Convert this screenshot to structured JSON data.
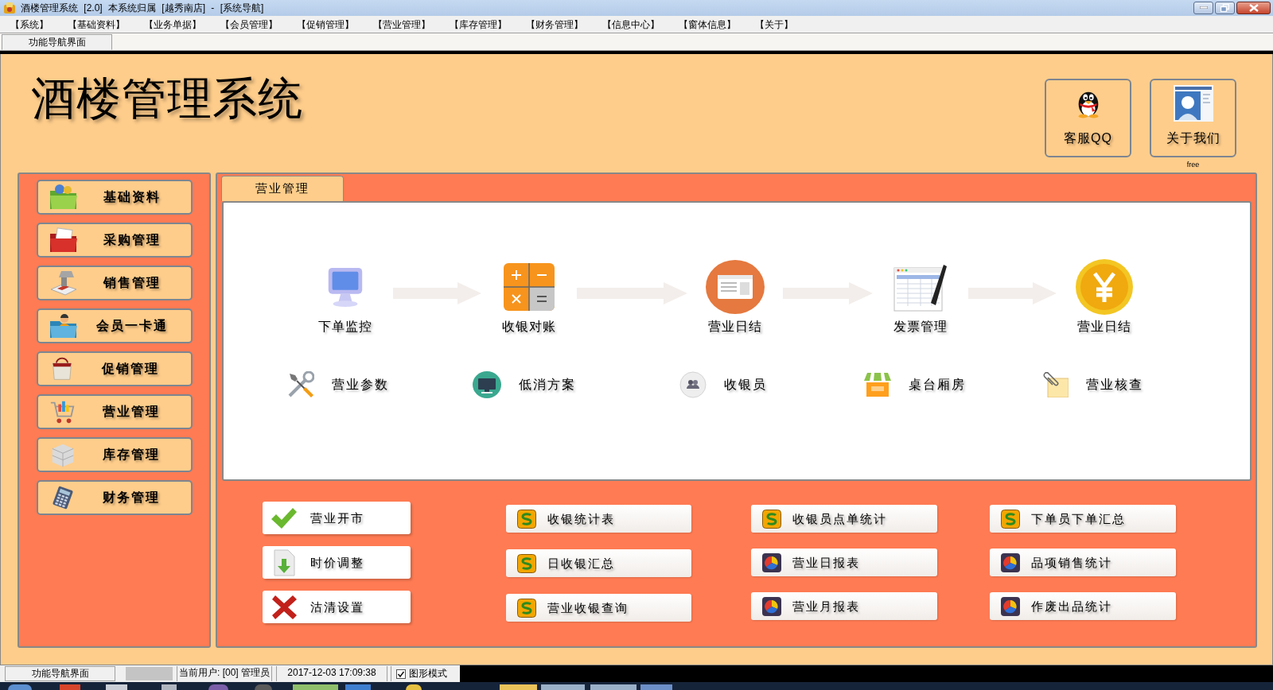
{
  "window": {
    "title": "酒楼管理系统 [2.0] 本系统归属 [越秀南店] - [系统导航]"
  },
  "menu": [
    "【系统】",
    "【基础资料】",
    "【业务单据】",
    "【会员管理】",
    "【促销管理】",
    "【营业管理】",
    "【库存管理】",
    "【财务管理】",
    "【信息中心】",
    "【窗体信息】",
    "【关于】"
  ],
  "tabs": [
    {
      "label": "功能导航界面",
      "selected": true
    }
  ],
  "header": {
    "title": "酒楼管理系统",
    "buttons": [
      "客服QQ",
      "关于我们"
    ],
    "note": "free"
  },
  "sidebar": {
    "items": [
      "基础资料",
      "采购管理",
      "销售管理",
      "会员一卡通",
      "促销管理",
      "营业管理",
      "库存管理",
      "财务管理"
    ]
  },
  "panel": {
    "tabs": [
      {
        "label": "营业管理",
        "selected": true
      }
    ],
    "flow": [
      "下单监控",
      "收银对账",
      "营业日结",
      "发票管理",
      "营业日结"
    ],
    "shortcuts": [
      "营业参数",
      "低消方案",
      "收银员",
      "桌台厢房",
      "营业核查"
    ],
    "actions": [
      [
        "营业开市",
        "时价调整",
        "沽清设置"
      ],
      [
        "收银统计表",
        "日收银汇总",
        "营业收银查询"
      ],
      [
        "收银员点单统计",
        "营业日报表",
        "营业月报表"
      ],
      [
        "下单员下单汇总",
        "品项销售统计",
        "作废出品统计"
      ]
    ]
  },
  "status_bar": {
    "page": "功能导航界面",
    "user": "当前用户: [00] 管理员",
    "datetime": "2017-12-03 17:09:38",
    "graphic_mode": {
      "label": "图形模式",
      "checked": true
    }
  }
}
